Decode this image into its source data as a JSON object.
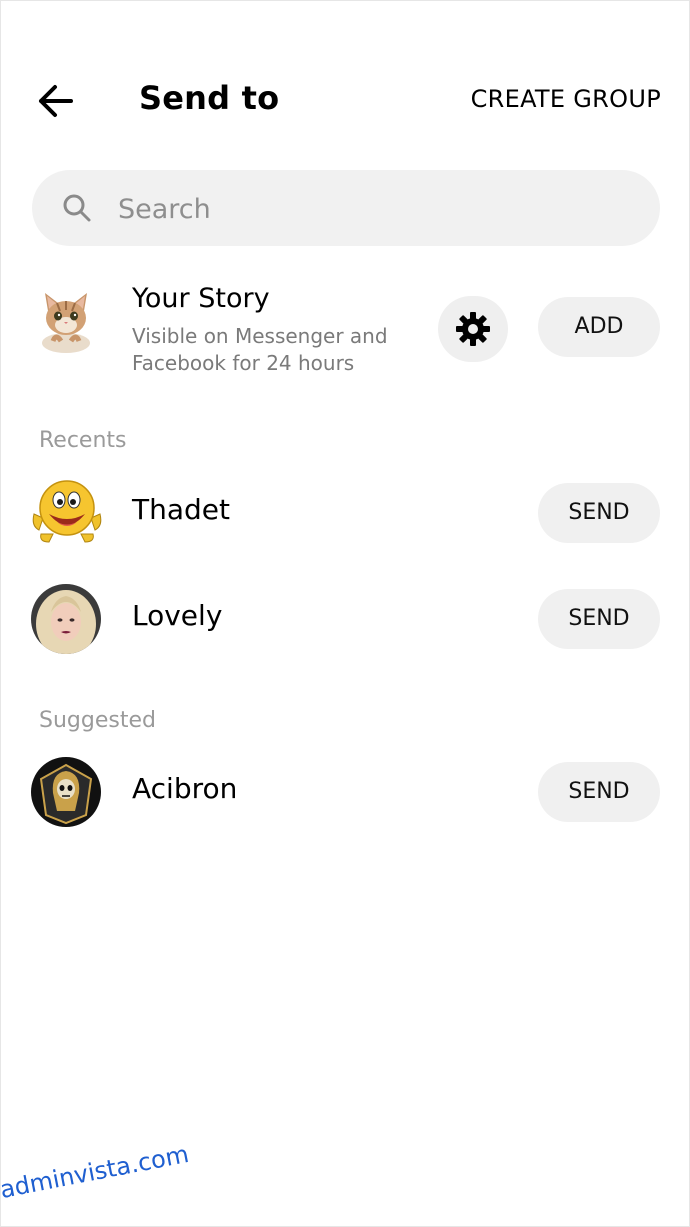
{
  "header": {
    "title": "Send to",
    "create_group_label": "CREATE GROUP"
  },
  "search": {
    "placeholder": "Search"
  },
  "story": {
    "name": "Your Story",
    "subtitle": "Visible on Messenger and Facebook for 24 hours",
    "add_label": "ADD",
    "settings_icon": "gear-icon"
  },
  "sections": {
    "recents_label": "Recents",
    "suggested_label": "Suggested"
  },
  "recents": [
    {
      "name": "Thadet",
      "button_label": "SEND"
    },
    {
      "name": "Lovely",
      "button_label": "SEND"
    }
  ],
  "suggested": [
    {
      "name": "Acibron",
      "button_label": "SEND"
    }
  ],
  "watermark": "adminvista.com",
  "colors": {
    "pill_background": "#f0f0f0",
    "secondary_text": "#7a7a7a",
    "section_label": "#9a9a9a",
    "watermark": "#1f5fd0"
  }
}
